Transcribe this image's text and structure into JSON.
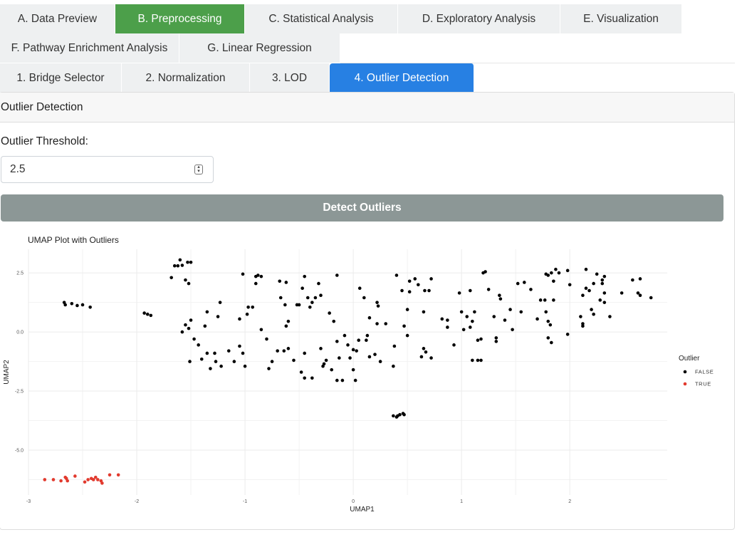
{
  "main_tabs": [
    {
      "label": "A. Data Preview",
      "active": false
    },
    {
      "label": "B. Preprocessing",
      "active": true
    },
    {
      "label": "C. Statistical Analysis",
      "active": false
    },
    {
      "label": "D. Exploratory Analysis",
      "active": false
    },
    {
      "label": "E. Visualization",
      "active": false
    },
    {
      "label": "F. Pathway Enrichment Analysis",
      "active": false
    },
    {
      "label": "G. Linear Regression",
      "active": false
    }
  ],
  "sub_tabs": [
    {
      "label": "1. Bridge Selector",
      "active": false
    },
    {
      "label": "2. Normalization",
      "active": false
    },
    {
      "label": "3. LOD",
      "active": false
    },
    {
      "label": "4. Outlier Detection",
      "active": true
    }
  ],
  "panel": {
    "title": "Outlier Detection",
    "threshold_label": "Outlier Threshold:",
    "threshold_value": "2.5",
    "detect_button": "Detect Outliers"
  },
  "colors": {
    "active_main_tab": "#4c9f4a",
    "active_sub_tab": "#2780e3",
    "button": "#8c9796",
    "outlier_true": "#e23a2e",
    "outlier_false": "#000000"
  },
  "chart_data": {
    "type": "scatter",
    "title": "UMAP Plot with Outliers",
    "xlabel": "UMAP1",
    "ylabel": "UMAP2",
    "xlim": [
      -3.0,
      2.9
    ],
    "ylim": [
      -6.9,
      3.5
    ],
    "xticks": [
      -3,
      -2,
      -1,
      0,
      1,
      2
    ],
    "yticks": [
      2.5,
      0.0,
      -2.5,
      -5.0
    ],
    "grid": true,
    "legend": {
      "title": "Outlier",
      "entries": [
        "FALSE",
        "TRUE"
      ],
      "position": "right"
    },
    "series": [
      {
        "name": "FALSE",
        "color": "#000000",
        "points": [
          [
            -2.67,
            1.25
          ],
          [
            -2.66,
            1.15
          ],
          [
            -2.6,
            1.2
          ],
          [
            -2.55,
            1.12
          ],
          [
            -2.5,
            1.15
          ],
          [
            -2.43,
            1.05
          ],
          [
            -1.93,
            0.8
          ],
          [
            -1.9,
            0.75
          ],
          [
            -1.87,
            0.7
          ],
          [
            -1.6,
            3.05
          ],
          [
            -1.58,
            2.82
          ],
          [
            -1.62,
            2.8
          ],
          [
            -1.65,
            2.8
          ],
          [
            -1.53,
            2.95
          ],
          [
            -1.5,
            2.95
          ],
          [
            -1.68,
            2.3
          ],
          [
            -1.55,
            2.2
          ],
          [
            -1.52,
            2.05
          ],
          [
            -1.5,
            0.5
          ],
          [
            -1.52,
            0.15
          ],
          [
            -1.47,
            -0.3
          ],
          [
            -1.55,
            0.3
          ],
          [
            -1.58,
            0.0
          ],
          [
            -1.43,
            -0.55
          ],
          [
            -1.51,
            -1.25
          ],
          [
            -1.4,
            -1.15
          ],
          [
            -1.35,
            -0.9
          ],
          [
            -1.32,
            -1.55
          ],
          [
            -1.27,
            -1.25
          ],
          [
            -1.22,
            -1.45
          ],
          [
            -1.28,
            -0.9
          ],
          [
            -1.37,
            0.25
          ],
          [
            -1.35,
            0.85
          ],
          [
            -1.25,
            0.65
          ],
          [
            -1.23,
            1.25
          ],
          [
            -1.15,
            -0.8
          ],
          [
            -1.1,
            -1.25
          ],
          [
            -1.05,
            0.55
          ],
          [
            -1.02,
            2.45
          ],
          [
            -0.98,
            0.75
          ],
          [
            -0.97,
            1.05
          ],
          [
            -0.93,
            1.05
          ],
          [
            -1.0,
            -1.45
          ],
          [
            -1.05,
            -0.6
          ],
          [
            -1.02,
            -0.9
          ],
          [
            -0.85,
            0.1
          ],
          [
            -0.9,
            2.35
          ],
          [
            -0.88,
            2.4
          ],
          [
            -0.85,
            2.35
          ],
          [
            -0.9,
            2.05
          ],
          [
            -0.8,
            -0.3
          ],
          [
            -0.78,
            -1.55
          ],
          [
            -0.75,
            -1.25
          ],
          [
            -0.7,
            -0.8
          ],
          [
            -0.68,
            2.15
          ],
          [
            -0.62,
            2.1
          ],
          [
            -0.67,
            1.45
          ],
          [
            -0.63,
            1.15
          ],
          [
            -0.6,
            0.45
          ],
          [
            -0.62,
            0.25
          ],
          [
            -0.64,
            -0.8
          ],
          [
            -0.6,
            -0.7
          ],
          [
            -0.55,
            -1.2
          ],
          [
            -0.52,
            1.15
          ],
          [
            -0.5,
            1.15
          ],
          [
            -0.47,
            1.85
          ],
          [
            -0.45,
            2.35
          ],
          [
            -0.42,
            1.45
          ],
          [
            -0.4,
            1.05
          ],
          [
            -0.38,
            1.25
          ],
          [
            -0.35,
            1.45
          ],
          [
            -0.32,
            2.05
          ],
          [
            -0.3,
            1.55
          ],
          [
            -0.45,
            -0.9
          ],
          [
            -0.48,
            -1.7
          ],
          [
            -0.45,
            -1.95
          ],
          [
            -0.38,
            -1.95
          ],
          [
            -0.3,
            -0.7
          ],
          [
            -0.27,
            -1.35
          ],
          [
            -0.25,
            -1.2
          ],
          [
            -0.28,
            -1.45
          ],
          [
            -0.2,
            -1.6
          ],
          [
            -0.15,
            -2.05
          ],
          [
            -0.1,
            -2.05
          ],
          [
            -0.15,
            2.4
          ],
          [
            -0.22,
            0.8
          ],
          [
            -0.18,
            0.45
          ],
          [
            -0.15,
            -0.4
          ],
          [
            -0.13,
            -1.1
          ],
          [
            -0.08,
            -0.15
          ],
          [
            -0.05,
            -0.55
          ],
          [
            -0.03,
            -1.1
          ],
          [
            0.0,
            -1.6
          ],
          [
            0.02,
            -2.05
          ],
          [
            0.0,
            -0.75
          ],
          [
            0.03,
            -0.8
          ],
          [
            0.05,
            -0.35
          ],
          [
            0.06,
            1.85
          ],
          [
            0.1,
            1.45
          ],
          [
            0.12,
            -0.35
          ],
          [
            0.15,
            -1.05
          ],
          [
            0.13,
            -0.15
          ],
          [
            0.15,
            0.6
          ],
          [
            0.2,
            -0.95
          ],
          [
            0.22,
            1.25
          ],
          [
            0.23,
            1.1
          ],
          [
            0.22,
            0.35
          ],
          [
            0.3,
            0.35
          ],
          [
            0.25,
            -1.25
          ],
          [
            0.37,
            -1.45
          ],
          [
            0.38,
            -0.6
          ],
          [
            0.4,
            2.4
          ],
          [
            0.45,
            1.75
          ],
          [
            0.52,
            1.7
          ],
          [
            0.5,
            -0.15
          ],
          [
            0.47,
            0.25
          ],
          [
            0.5,
            0.95
          ],
          [
            0.52,
            2.15
          ],
          [
            0.57,
            2.25
          ],
          [
            0.6,
            2.0
          ],
          [
            0.66,
            1.75
          ],
          [
            0.65,
            0.85
          ],
          [
            0.63,
            -1.05
          ],
          [
            0.65,
            -0.7
          ],
          [
            0.67,
            -0.85
          ],
          [
            0.72,
            -1.1
          ],
          [
            0.72,
            2.25
          ],
          [
            0.7,
            1.75
          ],
          [
            0.82,
            0.55
          ],
          [
            0.87,
            0.2
          ],
          [
            0.87,
            0.5
          ],
          [
            0.93,
            -0.55
          ],
          [
            0.98,
            1.65
          ],
          [
            1.0,
            0.85
          ],
          [
            1.02,
            0.1
          ],
          [
            1.05,
            0.65
          ],
          [
            1.08,
            0.2
          ],
          [
            1.1,
            -1.2
          ],
          [
            1.1,
            0.45
          ],
          [
            1.12,
            0.85
          ],
          [
            1.15,
            -1.2
          ],
          [
            1.15,
            -0.35
          ],
          [
            1.18,
            -1.2
          ],
          [
            1.18,
            -0.3
          ],
          [
            1.2,
            2.5
          ],
          [
            1.22,
            2.55
          ],
          [
            1.25,
            1.8
          ],
          [
            1.08,
            1.75
          ],
          [
            1.3,
            0.65
          ],
          [
            1.32,
            -0.25
          ],
          [
            1.32,
            -0.4
          ],
          [
            1.35,
            1.55
          ],
          [
            1.36,
            1.4
          ],
          [
            1.4,
            0.5
          ],
          [
            1.45,
            0.95
          ],
          [
            1.47,
            0.1
          ],
          [
            1.52,
            2.05
          ],
          [
            1.55,
            0.85
          ],
          [
            1.58,
            2.1
          ],
          [
            1.64,
            1.8
          ],
          [
            1.73,
            1.35
          ],
          [
            1.77,
            1.35
          ],
          [
            1.7,
            0.55
          ],
          [
            1.78,
            0.85
          ],
          [
            1.8,
            0.45
          ],
          [
            1.82,
            0.3
          ],
          [
            1.85,
            1.35
          ],
          [
            1.78,
            2.45
          ],
          [
            1.8,
            2.4
          ],
          [
            1.83,
            2.5
          ],
          [
            1.87,
            2.65
          ],
          [
            1.9,
            2.5
          ],
          [
            1.85,
            2.15
          ],
          [
            1.8,
            -0.25
          ],
          [
            1.83,
            -0.45
          ],
          [
            1.98,
            2.6
          ],
          [
            2.0,
            2.0
          ],
          [
            1.98,
            -0.1
          ],
          [
            2.12,
            1.55
          ],
          [
            2.1,
            0.65
          ],
          [
            2.12,
            0.35
          ],
          [
            2.12,
            0.25
          ],
          [
            2.15,
            2.65
          ],
          [
            2.15,
            1.85
          ],
          [
            2.18,
            1.75
          ],
          [
            2.2,
            0.95
          ],
          [
            2.22,
            0.75
          ],
          [
            2.22,
            2.05
          ],
          [
            2.25,
            2.45
          ],
          [
            2.28,
            1.35
          ],
          [
            2.3,
            2.05
          ],
          [
            2.32,
            1.25
          ],
          [
            2.32,
            1.65
          ],
          [
            2.3,
            2.2
          ],
          [
            2.32,
            2.35
          ],
          [
            2.37,
            0.65
          ],
          [
            2.48,
            1.65
          ],
          [
            2.58,
            2.2
          ],
          [
            2.65,
            2.25
          ],
          [
            2.63,
            1.65
          ],
          [
            2.65,
            1.55
          ],
          [
            2.75,
            1.45
          ],
          [
            0.37,
            -3.55
          ],
          [
            0.4,
            -3.6
          ],
          [
            0.43,
            -3.5
          ],
          [
            0.46,
            -3.45
          ],
          [
            0.47,
            -3.5
          ],
          [
            0.41,
            -3.55
          ]
        ]
      },
      {
        "name": "TRUE",
        "color": "#e23a2e",
        "points": [
          [
            -2.85,
            -6.25
          ],
          [
            -2.77,
            -6.25
          ],
          [
            -2.7,
            -6.3
          ],
          [
            -2.66,
            -6.15
          ],
          [
            -2.65,
            -6.2
          ],
          [
            -2.64,
            -6.3
          ],
          [
            -2.57,
            -6.1
          ],
          [
            -2.48,
            -6.35
          ],
          [
            -2.45,
            -6.25
          ],
          [
            -2.42,
            -6.2
          ],
          [
            -2.4,
            -6.25
          ],
          [
            -2.38,
            -6.15
          ],
          [
            -2.36,
            -6.25
          ],
          [
            -2.33,
            -6.3
          ],
          [
            -2.32,
            -6.4
          ],
          [
            -2.25,
            -6.05
          ],
          [
            -2.17,
            -6.05
          ]
        ]
      }
    ]
  }
}
